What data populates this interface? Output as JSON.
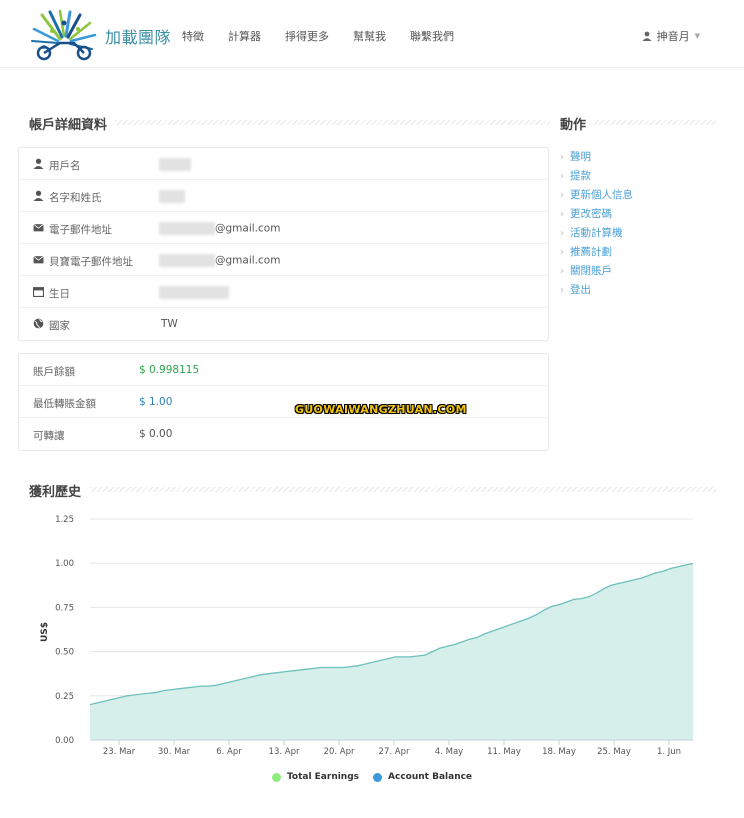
{
  "header": {
    "brand": "加載團隊",
    "nav": [
      "特徵",
      "計算器",
      "掙得更多",
      "幫幫我",
      "聯繫我們"
    ],
    "user": "抻音月"
  },
  "account": {
    "title": "帳戶詳細資料",
    "rows": [
      {
        "icon": "user-icon",
        "label": "用戶名",
        "value": ""
      },
      {
        "icon": "user-icon",
        "label": "名字和姓氏",
        "value": ""
      },
      {
        "icon": "envelope-icon",
        "label": "電子郵件地址",
        "value": "@gmail.com"
      },
      {
        "icon": "envelope-icon",
        "label": "貝寶電子郵件地址",
        "value": "@gmail.com"
      },
      {
        "icon": "calendar-icon",
        "label": "生日",
        "value": ""
      },
      {
        "icon": "globe-icon",
        "label": "國家",
        "value": "TW"
      }
    ]
  },
  "balance": {
    "rows": [
      {
        "label": "賬戶餘額",
        "value": "$ 0.998115",
        "color": "#2aa34a"
      },
      {
        "label": "最低轉賬金額",
        "value": "$ 1.00",
        "color": "#2f7fb5"
      },
      {
        "label": "可轉讓",
        "value": "$ 0.00",
        "color": "#555555"
      }
    ]
  },
  "actions": {
    "title": "動作",
    "items": [
      "聲明",
      "提款",
      "更新個人信息",
      "更改密碼",
      "活動計算機",
      "推薦計劃",
      "關閉賬戶",
      "登出"
    ]
  },
  "watermark": "GUOWAIWANGZHUAN.COM",
  "history": {
    "title": "獲利歷史"
  },
  "chart_data": {
    "type": "area",
    "ylabel": "US$",
    "ylim": [
      0,
      1.25
    ],
    "yticks": [
      "0.00",
      "0.25",
      "0.50",
      "0.75",
      "1.00",
      "1.25"
    ],
    "xticks": [
      "23. Mar",
      "30. Mar",
      "6. Apr",
      "13. Apr",
      "20. Apr",
      "27. Apr",
      "4. May",
      "11. May",
      "18. May",
      "25. May",
      "1. Jun"
    ],
    "x_days": [
      0,
      1,
      2,
      3,
      4,
      5,
      6,
      7,
      8,
      9,
      10,
      11,
      12,
      13,
      14,
      15,
      16,
      17,
      18,
      19,
      20,
      21,
      22,
      23,
      24,
      25,
      26,
      27,
      28,
      29,
      30,
      31,
      32,
      33,
      34,
      35,
      36,
      37,
      38,
      39,
      40,
      41,
      42,
      43,
      44,
      45,
      46,
      47,
      48,
      49,
      50,
      51,
      52,
      53,
      54,
      55,
      56,
      57,
      58,
      59,
      60,
      61,
      62,
      63,
      64,
      65,
      66,
      67,
      68,
      69,
      70,
      71,
      72,
      73,
      74,
      75,
      76,
      77,
      78,
      79,
      80,
      81
    ],
    "series": [
      {
        "name": "Total Earnings",
        "color": "#90ed7d",
        "values": []
      },
      {
        "name": "Account Balance",
        "color": "#3a9ad9",
        "values": [
          0.2,
          0.21,
          0.22,
          0.23,
          0.24,
          0.25,
          0.255,
          0.26,
          0.265,
          0.27,
          0.28,
          0.285,
          0.29,
          0.295,
          0.3,
          0.305,
          0.305,
          0.31,
          0.32,
          0.33,
          0.34,
          0.35,
          0.36,
          0.37,
          0.375,
          0.38,
          0.385,
          0.39,
          0.395,
          0.4,
          0.405,
          0.41,
          0.41,
          0.41,
          0.41,
          0.415,
          0.42,
          0.43,
          0.44,
          0.45,
          0.46,
          0.47,
          0.47,
          0.47,
          0.475,
          0.48,
          0.5,
          0.52,
          0.53,
          0.54,
          0.555,
          0.57,
          0.58,
          0.6,
          0.615,
          0.63,
          0.645,
          0.66,
          0.675,
          0.69,
          0.71,
          0.735,
          0.755,
          0.765,
          0.78,
          0.795,
          0.8,
          0.81,
          0.83,
          0.855,
          0.875,
          0.885,
          0.895,
          0.905,
          0.915,
          0.93,
          0.945,
          0.955,
          0.97,
          0.98,
          0.99,
          0.998
        ]
      }
    ]
  }
}
